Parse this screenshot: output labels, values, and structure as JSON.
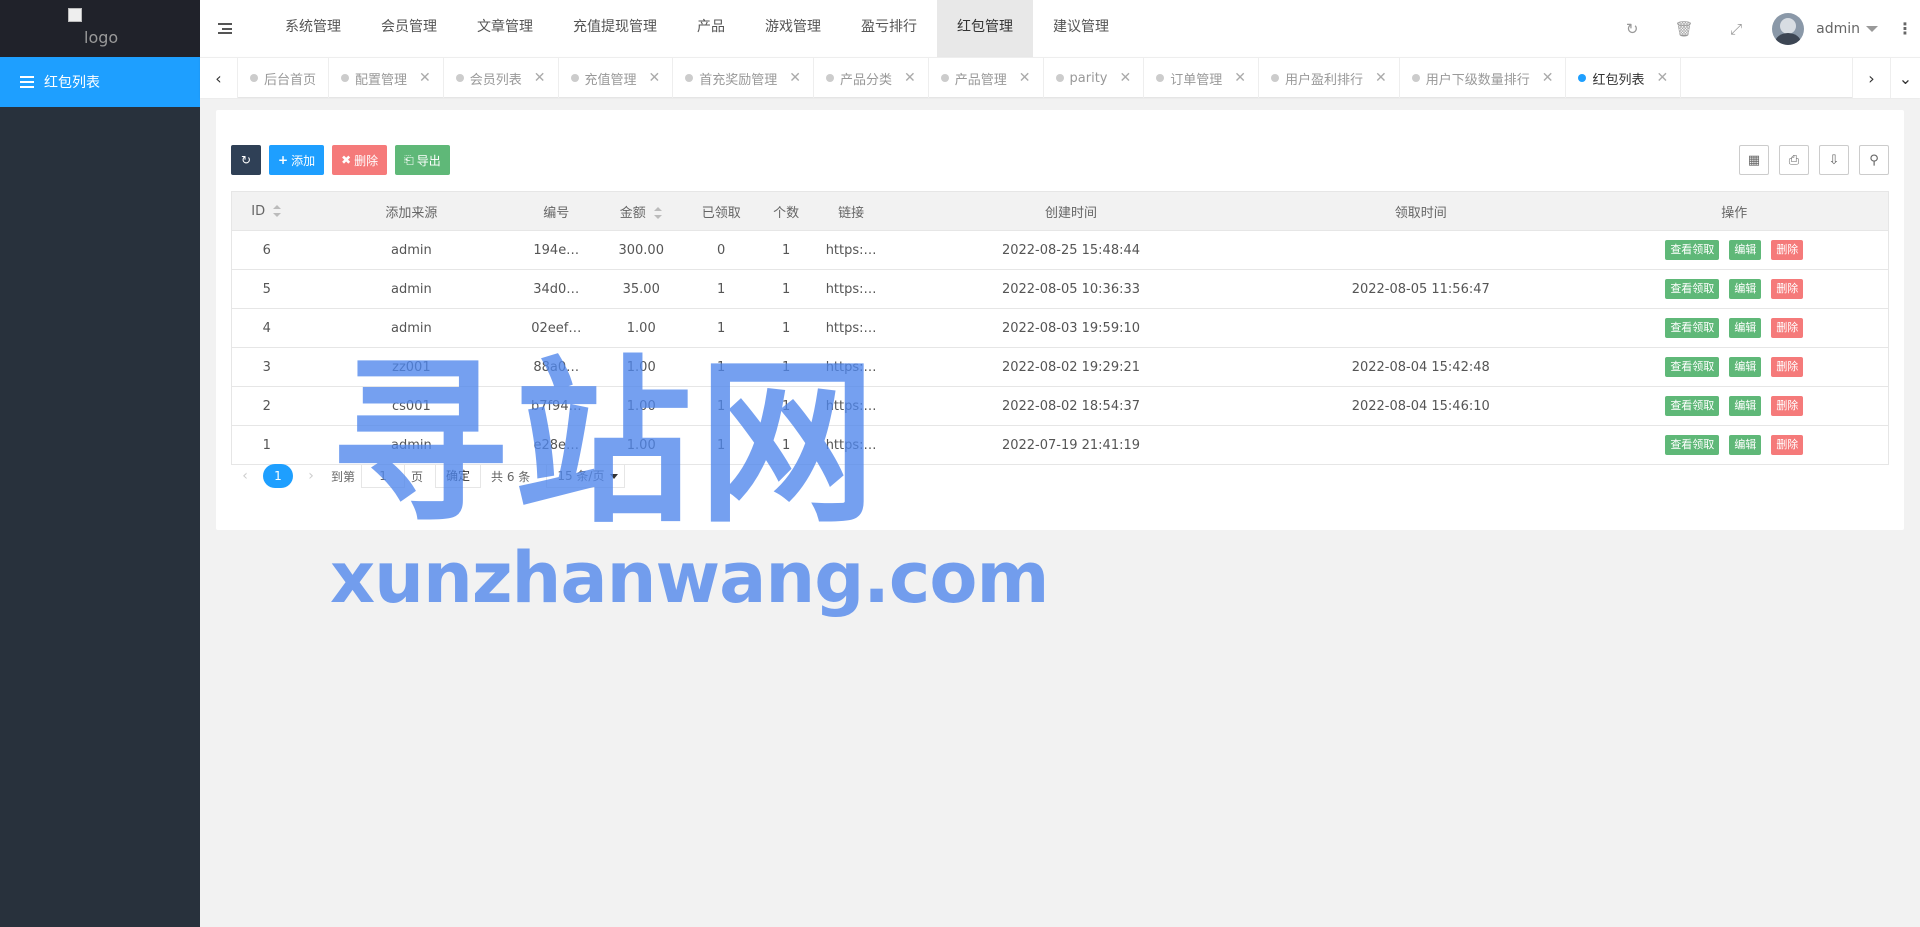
{
  "sidebar": {
    "logo_alt": "logo",
    "items": [
      {
        "label": "红包列表"
      }
    ]
  },
  "topbar": {
    "menu": [
      "系统管理",
      "会员管理",
      "文章管理",
      "充值提现管理",
      "产品",
      "游戏管理",
      "盈亏排行",
      "红包管理",
      "建议管理"
    ],
    "active_menu": "红包管理",
    "username": "admin"
  },
  "tabs": [
    {
      "label": "后台首页"
    },
    {
      "label": "配置管理"
    },
    {
      "label": "会员列表"
    },
    {
      "label": "充值管理"
    },
    {
      "label": "首充奖励管理"
    },
    {
      "label": "产品分类"
    },
    {
      "label": "产品管理"
    },
    {
      "label": "parity"
    },
    {
      "label": "订单管理"
    },
    {
      "label": "用户盈利排行"
    },
    {
      "label": "用户下级数量排行"
    },
    {
      "label": "红包列表"
    }
  ],
  "toolbar": {
    "add": "添加",
    "delete": "删除",
    "export": "导出"
  },
  "table": {
    "headers": [
      "ID",
      "添加来源",
      "编号",
      "金额",
      "已领取",
      "个数",
      "链接",
      "创建时间",
      "领取时间",
      "操作"
    ],
    "rows": [
      {
        "id": "6",
        "source": "admin",
        "code": "194e…",
        "amount": "300.00",
        "received": "0",
        "count": "1",
        "link": "https:…",
        "created": "2022-08-25 15:48:44",
        "claimed": ""
      },
      {
        "id": "5",
        "source": "admin",
        "code": "34d0…",
        "amount": "35.00",
        "received": "1",
        "count": "1",
        "link": "https:…",
        "created": "2022-08-05 10:36:33",
        "claimed": "2022-08-05 11:56:47"
      },
      {
        "id": "4",
        "source": "admin",
        "code": "02eef…",
        "amount": "1.00",
        "received": "1",
        "count": "1",
        "link": "https:…",
        "created": "2022-08-03 19:59:10",
        "claimed": ""
      },
      {
        "id": "3",
        "source": "zz001",
        "code": "88a0…",
        "amount": "1.00",
        "received": "1",
        "count": "1",
        "link": "https:…",
        "created": "2022-08-02 19:29:21",
        "claimed": "2022-08-04 15:42:48"
      },
      {
        "id": "2",
        "source": "cs001",
        "code": "b7f94…",
        "amount": "1.00",
        "received": "1",
        "count": "1",
        "link": "https:…",
        "created": "2022-08-02 18:54:37",
        "claimed": "2022-08-04 15:46:10"
      },
      {
        "id": "1",
        "source": "admin",
        "code": "e28e…",
        "amount": "1.00",
        "received": "1",
        "count": "1",
        "link": "https:…",
        "created": "2022-07-19 21:41:19",
        "claimed": ""
      }
    ],
    "row_actions": {
      "view": "查看领取",
      "edit": "编辑",
      "delete": "删除"
    }
  },
  "pagination": {
    "current": "1",
    "goto_prefix": "到第",
    "goto_value": "1",
    "goto_suffix": "页",
    "confirm": "确定",
    "total": "共 6 条",
    "page_size": "15 条/页"
  },
  "watermark": {
    "line1": "寻站网",
    "line2": "xunzhanwang.com"
  },
  "colors": {
    "sidebar": "#28313c",
    "accent": "#1e9fff",
    "green": "#5fb878",
    "red": "#f56c6c"
  }
}
